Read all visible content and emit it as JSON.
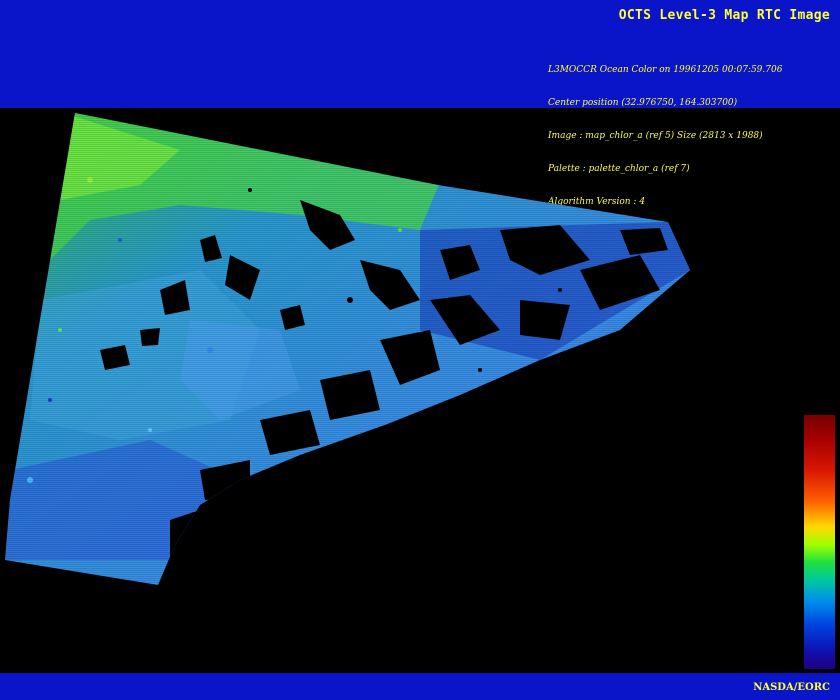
{
  "header": {
    "title": "OCTS Level-3 Map RTC Image",
    "meta_lines": [
      "L3MOCCR Ocean Color on 19961205 00:07:59.706",
      "Center position (32.976750, 164.303700)",
      "Image : map_chlor_a (ref 5) Size (2813 x 1988)",
      "Palette : palette_chlor_a (ref 7)",
      "Algorithm Version : 4"
    ]
  },
  "footer": {
    "credit": "NASDA/EORC"
  },
  "colors": {
    "banner": "#0a14c8",
    "text": "#ffff3c",
    "background": "#000000"
  }
}
